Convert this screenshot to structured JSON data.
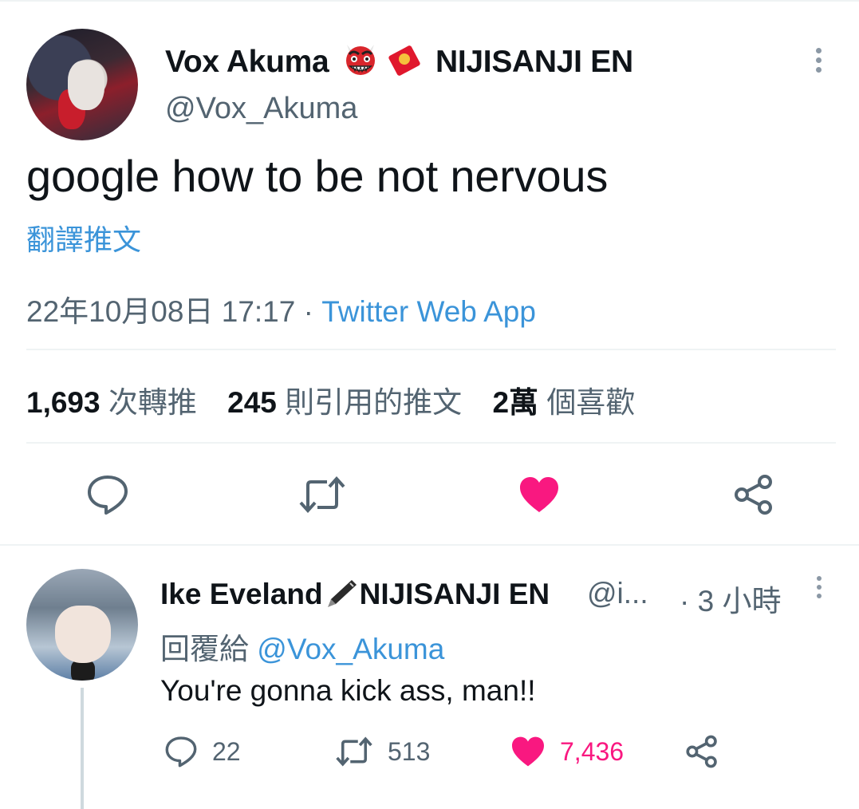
{
  "main_tweet": {
    "author_name": "Vox Akuma",
    "author_affiliation": "NIJISANJI EN",
    "handle": "@Vox_Akuma",
    "text": "google how to be not nervous",
    "translate_label": "翻譯推文",
    "timestamp": "22年10月08日 17:17",
    "separator": "·",
    "source_app": "Twitter Web App",
    "stats": {
      "retweets_count": "1,693",
      "retweets_label": "次轉推",
      "quotes_count": "245",
      "quotes_label": "則引用的推文",
      "likes_count": "2萬",
      "likes_label": "個喜歡"
    },
    "liked": true,
    "colors": {
      "like": "#f91880",
      "link": "#3b94d9",
      "secondary": "#536471"
    }
  },
  "reply": {
    "author_name": "Ike Eveland",
    "author_affiliation": "NIJISANJI EN",
    "handle": "@i...",
    "time": "· 3 小時",
    "replying_to_label": "回覆給",
    "replying_to_handle": "@Vox_Akuma",
    "text": "You're gonna kick ass, man!!",
    "reply_count": "22",
    "retweet_count": "513",
    "like_count": "7,436",
    "liked": true
  }
}
